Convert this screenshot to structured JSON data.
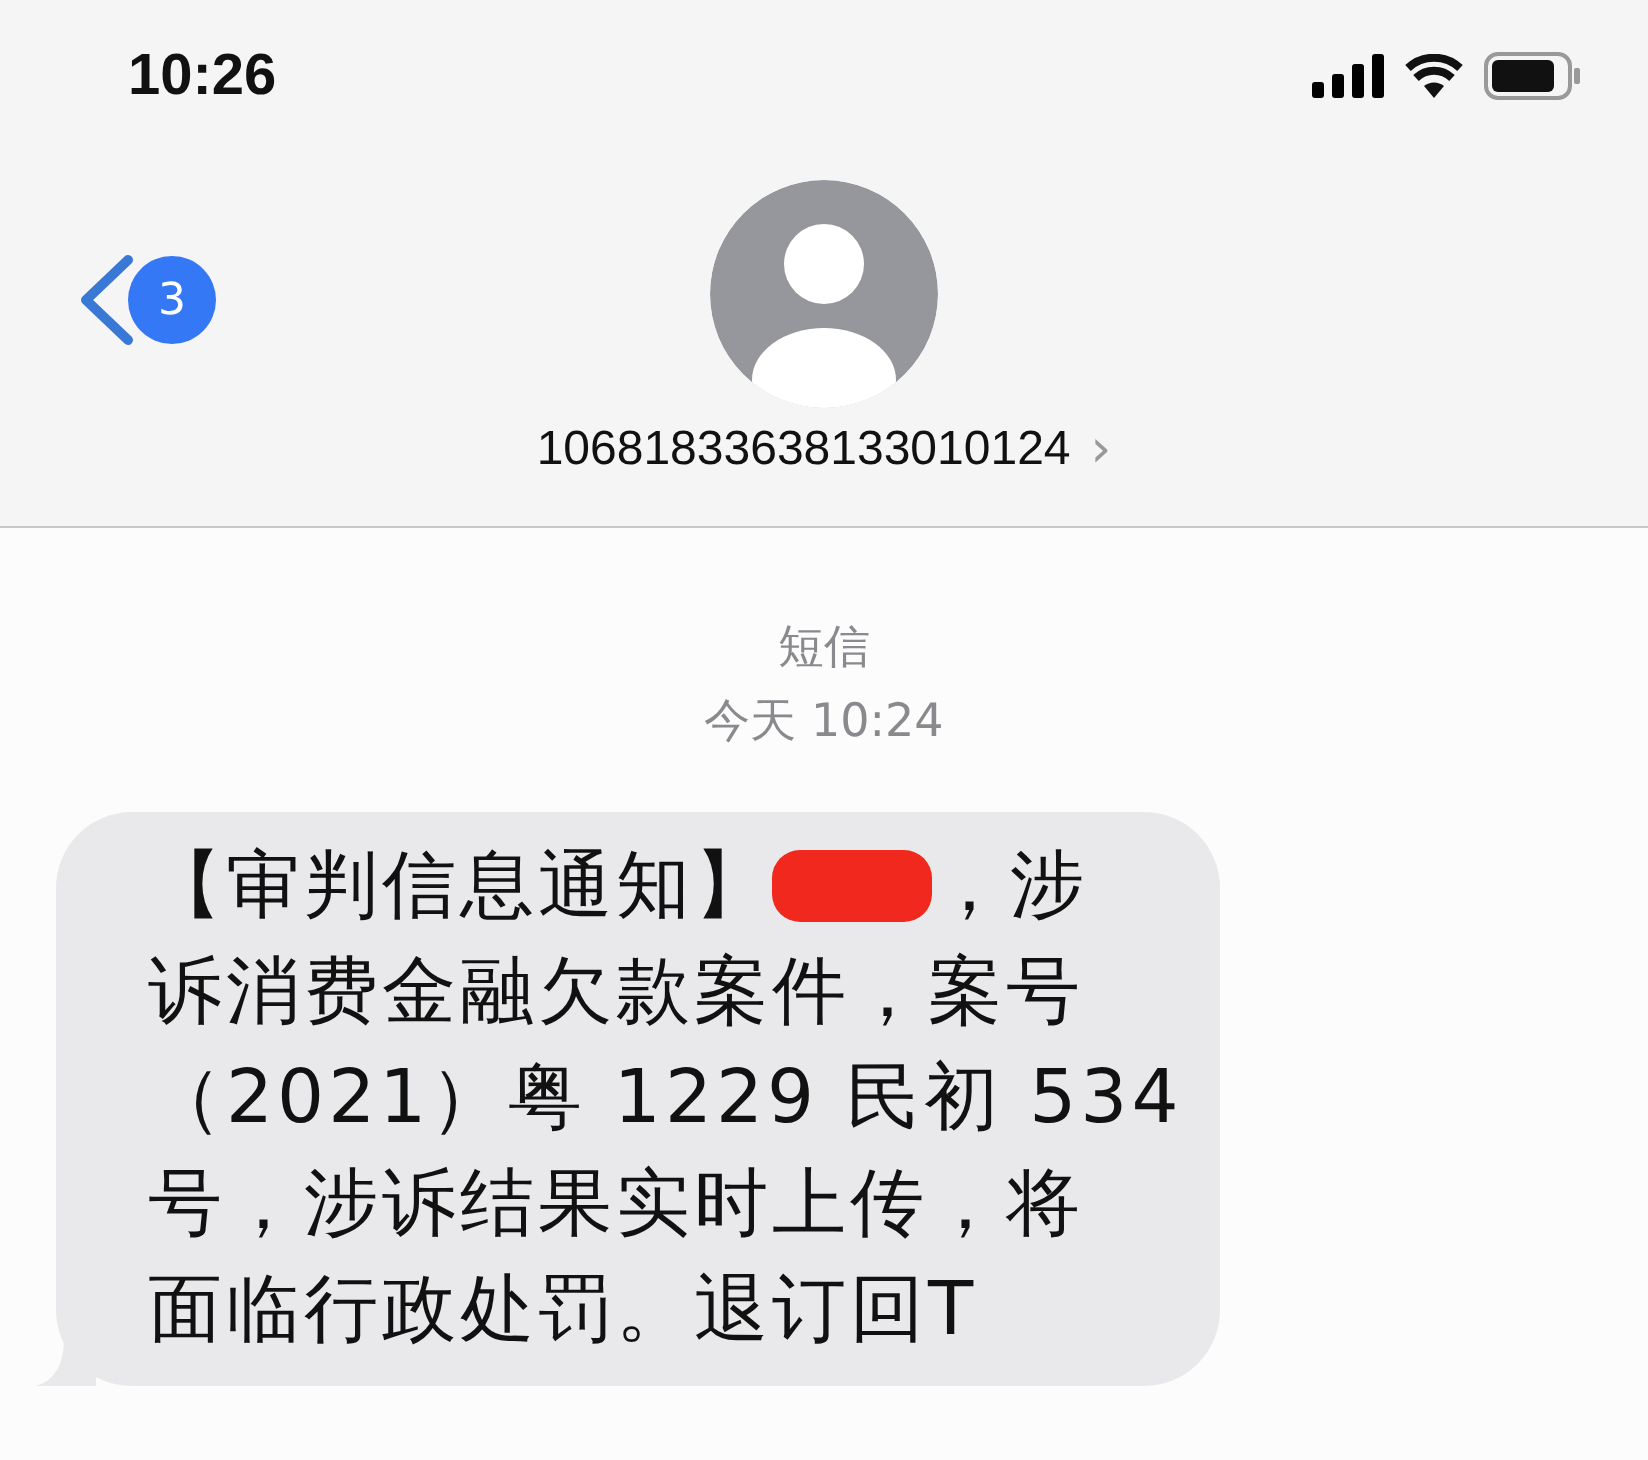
{
  "status_bar": {
    "time": "10:26"
  },
  "header": {
    "unread_count": "3",
    "contact": "10681833638133010124",
    "chevron": "›"
  },
  "thread": {
    "service": "短信",
    "timestamp": "今天 10:24"
  },
  "message": {
    "first_line_before": "【审判信息通知】",
    "redacted": true,
    "first_line_after": "，涉",
    "lines": [
      "诉消费金融欠款案件，案号",
      "（2021）粤 1229 民初 534",
      "号，涉诉结果实时上传，将",
      "面临行政处罚。退订回T"
    ]
  }
}
